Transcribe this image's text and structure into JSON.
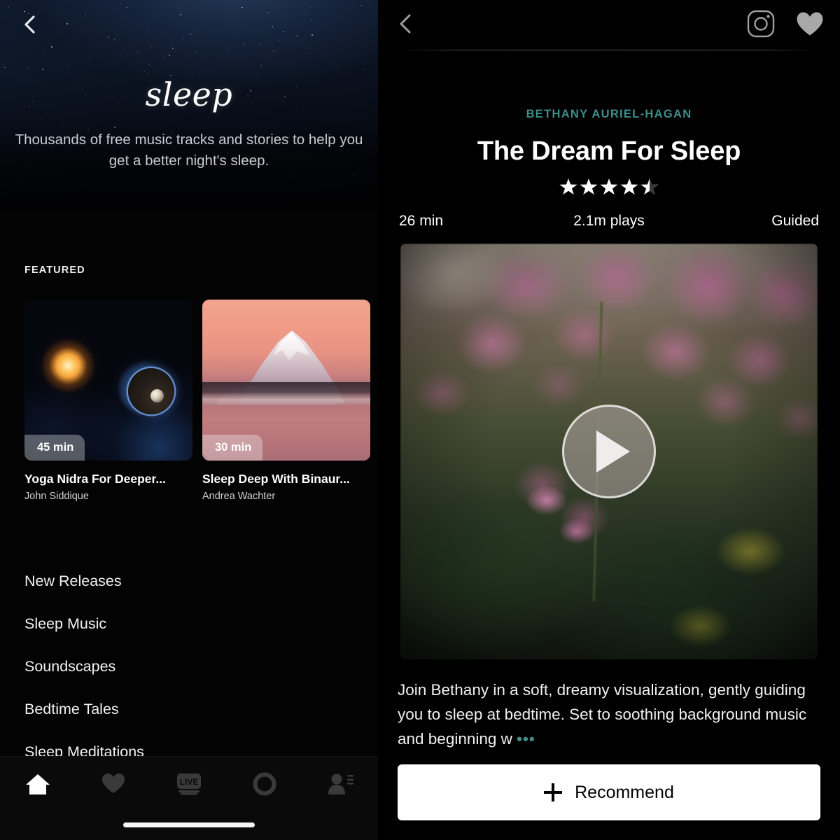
{
  "left": {
    "back_icon": "chevron-left-icon",
    "wordmark": "sleep",
    "subtitle": "Thousands of free music tracks and stories to help you get a better night's sleep.",
    "featured_label": "FEATURED",
    "cards": [
      {
        "badge": "45 min",
        "title": "Yoga Nidra For Deeper...",
        "author": "John Siddique",
        "art": "space-sun-planet"
      },
      {
        "badge": "30 min",
        "title": "Sleep Deep With Binaur...",
        "author": "Andrea Wachter",
        "art": "mount-fuji-sunrise"
      }
    ],
    "nav_items": [
      {
        "label": "New Releases"
      },
      {
        "label": "Sleep Music"
      },
      {
        "label": "Soundscapes"
      },
      {
        "label": "Bedtime Tales"
      },
      {
        "label": "Sleep Meditations"
      }
    ],
    "tabbar": [
      {
        "icon": "home-icon",
        "active": true
      },
      {
        "icon": "heart-icon",
        "active": false
      },
      {
        "icon": "live-tv-icon",
        "active": false
      },
      {
        "icon": "circle-icon",
        "active": false
      },
      {
        "icon": "profile-icon",
        "active": false
      }
    ]
  },
  "right": {
    "header": {
      "back_icon": "chevron-left-icon",
      "grid_icon": "grid-apps-icon",
      "camera_icon": "instagram-camera-icon",
      "heart_icon": "heart-icon"
    },
    "artist": "BETHANY AURIEL-HAGAN",
    "title": "The Dream For Sleep",
    "rating": 4.5,
    "rating_max": 5,
    "meta": {
      "duration": "26 min",
      "plays": "2.1m plays",
      "type": "Guided"
    },
    "hero": {
      "play_icon": "play-icon",
      "art": "pink-fireweed-flowers"
    },
    "description": "Join Bethany in a soft, dreamy visualization, gently guiding you to sleep at bedtime. Set to soothing background music and beginning w",
    "description_more": "•••",
    "recommend": {
      "icon": "plus-icon",
      "label": "Recommend"
    }
  },
  "colors": {
    "accent_teal": "#3f8e8a",
    "page_bg": "#000000",
    "sky_top": "#101d33",
    "badge_bg": "rgba(255,255,255,0.32)",
    "button_white": "#ffffff"
  }
}
